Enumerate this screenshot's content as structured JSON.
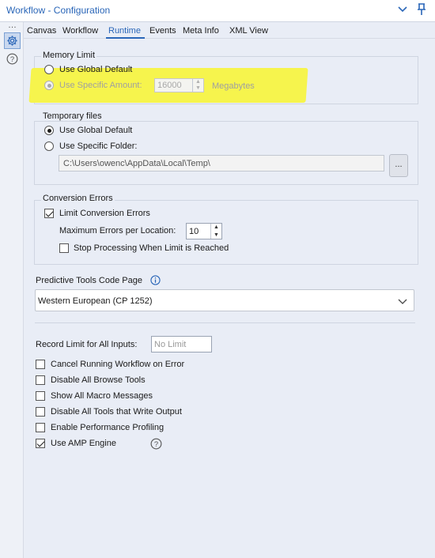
{
  "window": {
    "title": "Workflow - Configuration"
  },
  "tabs": [
    "Canvas",
    "Workflow",
    "Runtime",
    "Events",
    "Meta Info",
    "XML View"
  ],
  "active_tab": "Runtime",
  "memory_limit": {
    "legend": "Memory Limit",
    "global_label": "Use Global Default",
    "specific_label": "Use Specific Amount:",
    "amount": "16000",
    "unit": "Megabytes",
    "selected": "specific"
  },
  "temp_files": {
    "legend": "Temporary files",
    "global_label": "Use Global Default",
    "specific_label": "Use Specific Folder:",
    "path": "C:\\Users\\owenc\\AppData\\Local\\Temp\\",
    "browse_label": "...",
    "selected": "global"
  },
  "conversion_errors": {
    "legend": "Conversion Errors",
    "limit_label": "Limit Conversion Errors",
    "limit_checked": true,
    "max_label": "Maximum Errors per Location:",
    "max_value": "10",
    "stop_label": "Stop Processing When Limit is Reached",
    "stop_checked": false
  },
  "predictive": {
    "label": "Predictive Tools Code Page",
    "selected": "Western European (CP 1252)"
  },
  "record_limit": {
    "label": "Record Limit for All Inputs:",
    "placeholder": "No Limit"
  },
  "options": [
    {
      "label": "Cancel Running Workflow on Error",
      "checked": false
    },
    {
      "label": "Disable All Browse Tools",
      "checked": false
    },
    {
      "label": "Show All Macro Messages",
      "checked": false
    },
    {
      "label": "Disable All Tools that Write Output",
      "checked": false
    },
    {
      "label": "Enable Performance Profiling",
      "checked": false
    },
    {
      "label": "Use AMP Engine",
      "checked": true
    }
  ],
  "colors": {
    "accent": "#2a66b8",
    "highlight": "#f6f44d",
    "panel": "#e9edf6"
  }
}
